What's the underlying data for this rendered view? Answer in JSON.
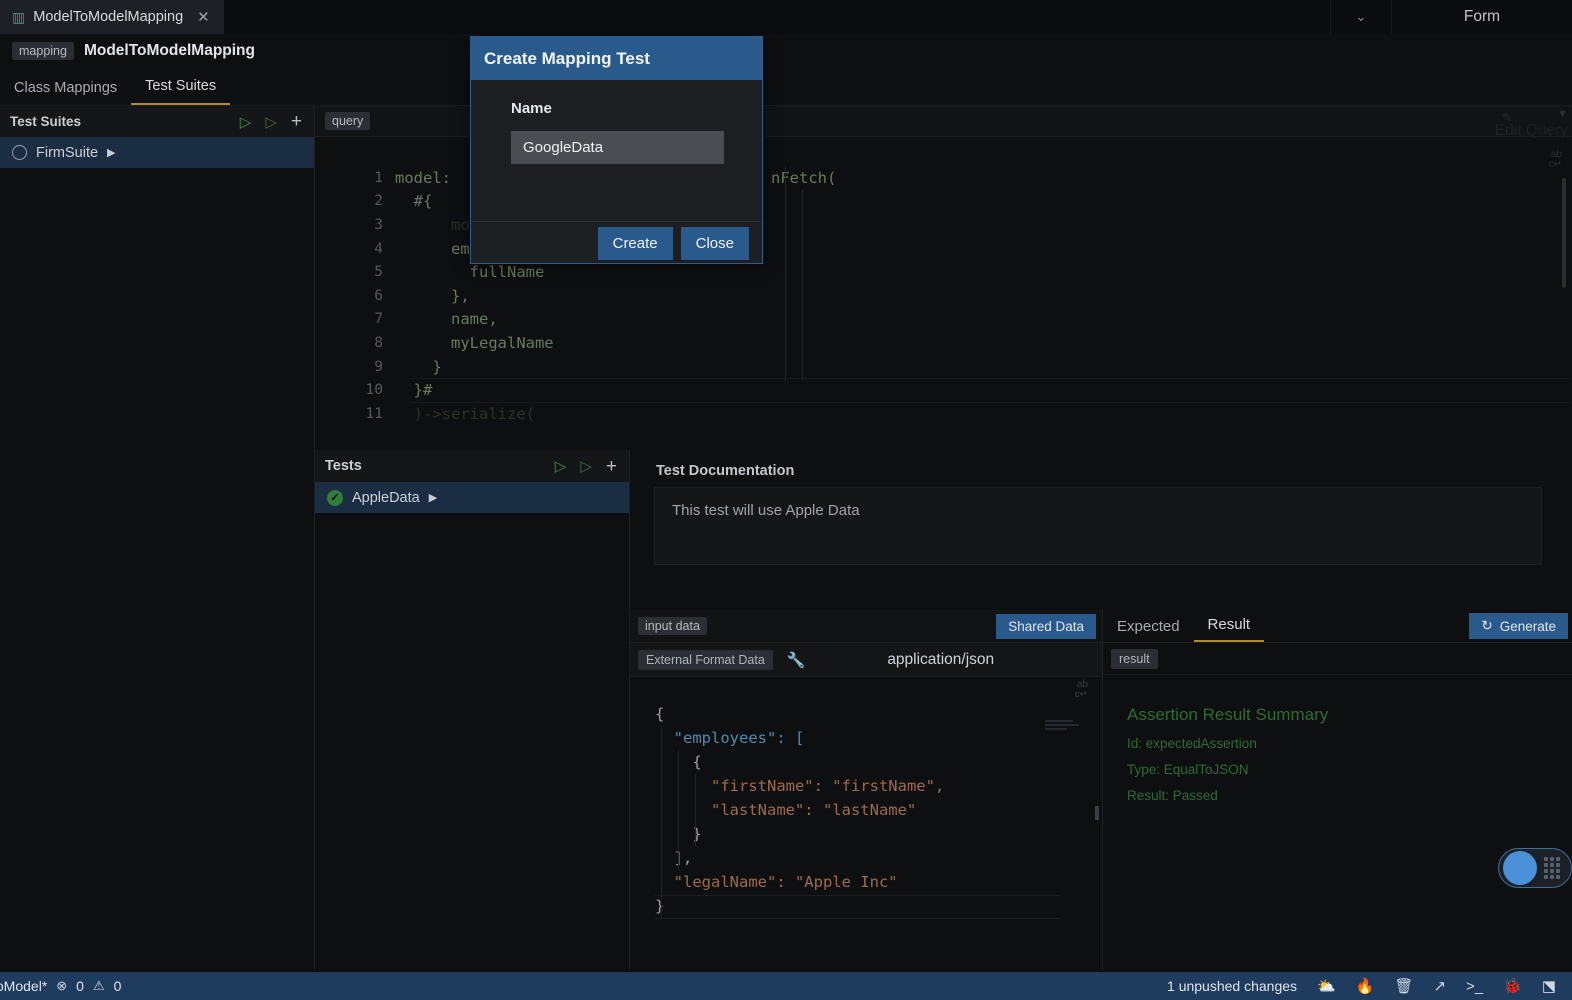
{
  "window": {
    "tab_title": "ModelToModelMapping",
    "tab_icon": "book-icon",
    "close_icon": "✕",
    "chevron_icon": "⌄",
    "form_label": "Form"
  },
  "breadcrumb": {
    "chip": "mapping",
    "title": "ModelToModelMapping"
  },
  "subtabs": [
    {
      "label": "Class Mappings",
      "selected": false
    },
    {
      "label": "Test Suites",
      "selected": true
    }
  ],
  "test_suites": {
    "header": "Test Suites",
    "run_icon": "▷",
    "run_debug_icon": "◁",
    "add_icon": "+",
    "items": [
      {
        "label": "FirmSuite",
        "status": "idle",
        "play": "▶"
      }
    ]
  },
  "query_editor": {
    "chip": "query",
    "edit_query_label": "Edit Query",
    "pencil_icon": "pencil-icon",
    "caret_icon": "▼",
    "wrap_icon": "word-wrap-icon",
    "lines": [
      {
        "n": "1",
        "text": "model:"
      },
      {
        "n": "2",
        "text": "  #{"
      },
      {
        "n": "3",
        "text": "      model::target::_Firm{"
      },
      {
        "n": "4",
        "text": "      employees{"
      },
      {
        "n": "5",
        "text": "        fullName"
      },
      {
        "n": "6",
        "text": "      },"
      },
      {
        "n": "7",
        "text": "      name,"
      },
      {
        "n": "8",
        "text": "      myLegalName"
      },
      {
        "n": "9",
        "text": "    }"
      },
      {
        "n": "10",
        "text": "  }#"
      },
      {
        "n": "11",
        "text": "  )->serialize("
      }
    ],
    "tail_text": "nFetch("
  },
  "tests": {
    "header": "Tests",
    "run_icon": "▷",
    "run_debug_icon": "◁",
    "add_icon": "+",
    "items": [
      {
        "label": "AppleData",
        "status": "passed",
        "play": "▶"
      }
    ]
  },
  "documentation": {
    "title": "Test Documentation",
    "text": "This test will use Apple Data"
  },
  "input_data": {
    "tab_chip": "input data",
    "shared_data_button": "Shared Data",
    "format_chip": "External Format Data",
    "wrench_icon": "wrench-icon",
    "mime_type": "application/json",
    "json_lines": [
      "{",
      "  \"employees\": [",
      "    {",
      "      \"firstName\": \"firstName\",",
      "      \"lastName\": \"lastName\"",
      "    }",
      "  ],",
      "  \"legalName\": \"Apple Inc\"",
      "}"
    ]
  },
  "result_panel": {
    "tabs": [
      {
        "label": "Expected",
        "selected": false
      },
      {
        "label": "Result",
        "selected": true
      }
    ],
    "generate_button": "Generate",
    "generate_icon": "↻",
    "result_chip": "result",
    "assertion": {
      "heading": "Assertion Result Summary",
      "id": "Id: expectedAssertion",
      "type": "Type: EqualToJSON",
      "result": "Result: Passed"
    }
  },
  "float_widget": {
    "name": "assistant-toggle",
    "circle_color": "#4a90d9"
  },
  "statusbar": {
    "project": "elToModel*",
    "error_icon": "⊗",
    "error_count": "0",
    "warning_icon": "⚠",
    "warning_count": "0",
    "unpushed": "1 unpushed changes",
    "icons": [
      "cloud-upload-icon",
      "flame-icon",
      "trash-icon",
      "arrow-up-right-icon",
      "terminal-icon",
      "bug-icon",
      "plugin-icon"
    ]
  },
  "modal": {
    "title": "Create Mapping Test",
    "name_label": "Name",
    "name_value": "GoogleData",
    "name_placeholder": "",
    "create_button": "Create",
    "close_button": "Close"
  },
  "colors": {
    "accent_blue": "#2a5a8c",
    "selection_blue": "#1b2d42",
    "tab_underline": "#b38b2a",
    "success_green": "#2f6b33",
    "statusbar_blue": "#1f3c5e"
  }
}
